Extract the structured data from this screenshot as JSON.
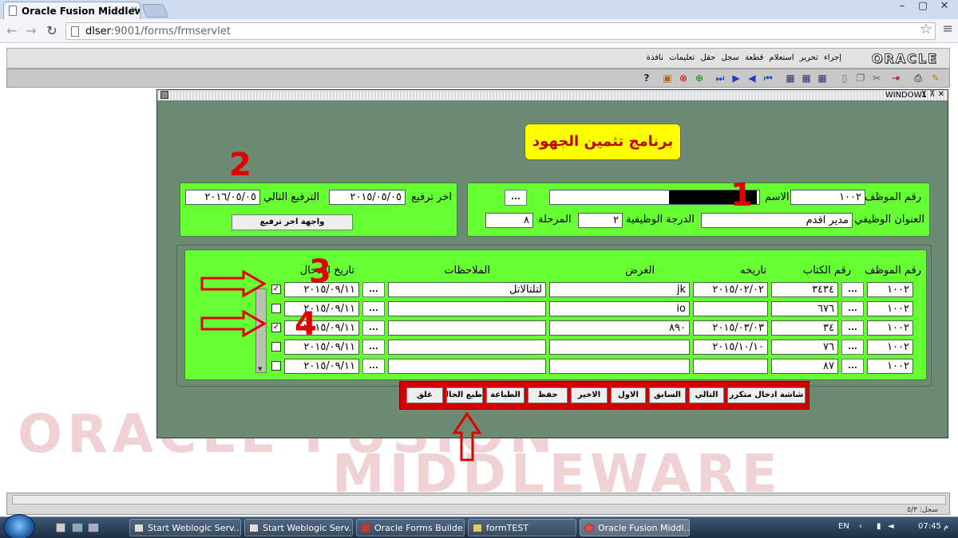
{
  "browser": {
    "tab_title": "Oracle Fusion Middleware",
    "tab_close": "×",
    "url_host": "dlser",
    "url_rest": ":9001/forms/frmservlet",
    "win_minimize": "–",
    "win_maximize": "▢",
    "win_close": "✕"
  },
  "app": {
    "logo": "ORACLE",
    "menu": [
      "إجراء",
      "تحرير",
      "استعلام",
      "قطعة",
      "سجل",
      "حقل",
      "تعليمات",
      "نافذة"
    ],
    "window_title": "WINDOW1",
    "window_btns": "⊻ ⊼ ✕"
  },
  "form": {
    "title": "برنامج تثمين الجهود",
    "emp_no_label": "رقم الموظف",
    "emp_no": "١٠٠٢",
    "name_label": "الاسم",
    "name_value": "",
    "lookup_btn": "...",
    "job_title_label": "العنوان الوظيفي",
    "job_title": "مدير اقدم",
    "grade_label": "الدرجة الوظيفية",
    "grade": "٢",
    "stage_label": "المرحلة",
    "stage": "٨",
    "last_promo_label": "اخر ترفيع",
    "last_promo": "٢٠١٥/٠٥/٠٥",
    "next_promo_label": "الترفيع التالي",
    "next_promo": "٢٠١٦/٠٥/٠٥",
    "promo_screen_btn": "واجهة اخر ترفيع"
  },
  "table": {
    "columns": {
      "emp_no": "رقم الموظف",
      "book_no": "رقم الكتاب",
      "book_date": "تاريخه",
      "purpose": "الغرض",
      "notes": "الملاحظات",
      "entry_date": "تاريخ الادخال"
    },
    "rows": [
      {
        "emp_no": "١٠٠٢",
        "book_no": "٣٤٣٤",
        "book_date": "٢٠١٥/٠٢/٠٢",
        "purpose": "jk",
        "notes": "لتلتالاتل",
        "entry_date": "٢٠١٥/٠٩/١١",
        "checked": true
      },
      {
        "emp_no": "١٠٠٢",
        "book_no": "٦٧٦",
        "book_date": "",
        "purpose": "io",
        "notes": "",
        "entry_date": "٢٠١٥/٠٩/١١",
        "checked": false
      },
      {
        "emp_no": "١٠٠٢",
        "book_no": "٣٤",
        "book_date": "٢٠١٥/٠٣/٠٣",
        "purpose": "٨٩٠",
        "notes": "",
        "entry_date": "٢٠١٥/٠٩/١١",
        "checked": true
      },
      {
        "emp_no": "١٠٠٢",
        "book_no": "٧٦",
        "book_date": "٢٠١٥/١٠/١٠",
        "purpose": "",
        "notes": "",
        "entry_date": "٢٠١٥/٠٩/١١",
        "checked": false
      },
      {
        "emp_no": "١٠٠٢",
        "book_no": "٨٧",
        "book_date": "",
        "purpose": "",
        "notes": "",
        "entry_date": "٢٠١٥/٠٩/١١",
        "checked": false
      }
    ],
    "dots": "...",
    "check_mark": "✓"
  },
  "buttons": {
    "multi_entry": "شاشة ادخال متكرر",
    "next": "التالي",
    "prev": "السابق",
    "first": "الاول",
    "last": "الاخير",
    "save": "حفظ",
    "print": "الطباعة",
    "print_current": "طبع الحالي",
    "close": "غلق"
  },
  "annotations": [
    "1",
    "2",
    "3",
    "4"
  ],
  "watermark": {
    "line1": "ORACLE FUSION",
    "line2": "MIDDLEWARE"
  },
  "status": {
    "record": "سجل: ٥/٣"
  },
  "taskbar": {
    "items": [
      "Start Weblogic Serv...",
      "Start Weblogic Serv...",
      "Oracle Forms Builde...",
      "formTEST",
      "Oracle Fusion Middl..."
    ],
    "lang": "EN",
    "time": "07:45 م"
  }
}
